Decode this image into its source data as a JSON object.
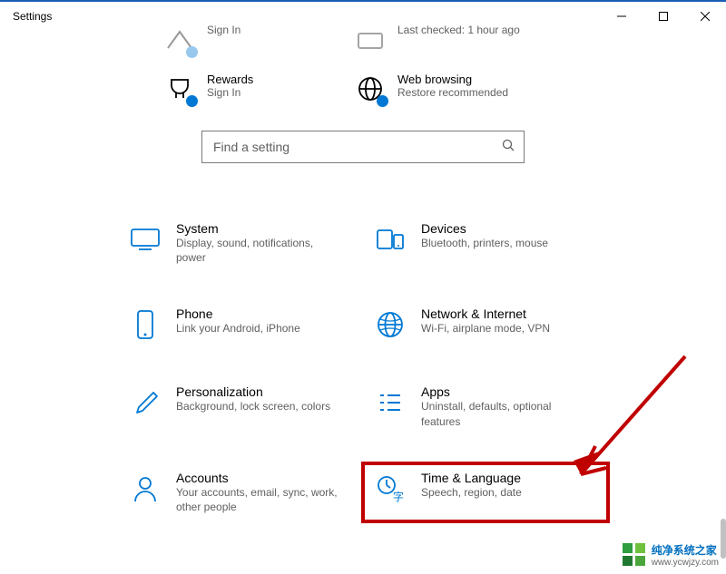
{
  "window": {
    "title": "Settings"
  },
  "status": {
    "tiles": [
      {
        "title": "",
        "sub": "Sign In"
      },
      {
        "title": "",
        "sub": "Last checked: 1 hour ago"
      },
      {
        "title": "Rewards",
        "sub": "Sign In"
      },
      {
        "title": "Web browsing",
        "sub": "Restore recommended"
      }
    ]
  },
  "search": {
    "placeholder": "Find a setting"
  },
  "categories": [
    {
      "title": "System",
      "sub": "Display, sound, notifications, power"
    },
    {
      "title": "Devices",
      "sub": "Bluetooth, printers, mouse"
    },
    {
      "title": "Phone",
      "sub": "Link your Android, iPhone"
    },
    {
      "title": "Network & Internet",
      "sub": "Wi-Fi, airplane mode, VPN"
    },
    {
      "title": "Personalization",
      "sub": "Background, lock screen, colors"
    },
    {
      "title": "Apps",
      "sub": "Uninstall, defaults, optional features"
    },
    {
      "title": "Accounts",
      "sub": "Your accounts, email, sync, work, other people"
    },
    {
      "title": "Time & Language",
      "sub": "Speech, region, date"
    }
  ],
  "watermark": {
    "line1": "纯净系统之家",
    "line2": "www.ycwjzy.com"
  },
  "colors": {
    "accent": "#0078d4",
    "highlight": "#c00000"
  }
}
